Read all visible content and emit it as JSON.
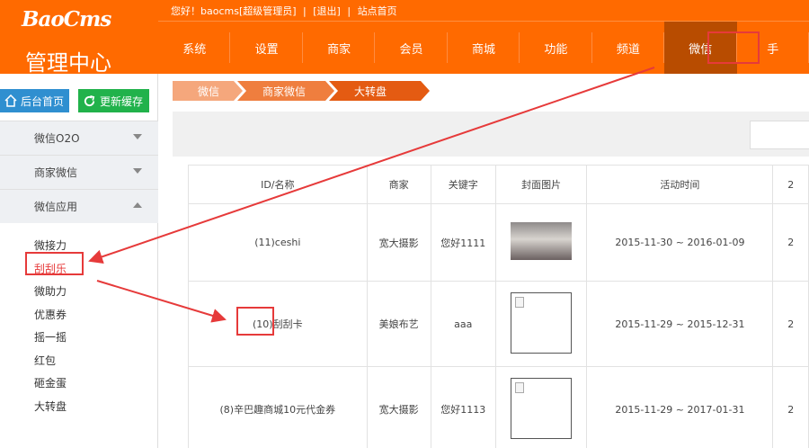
{
  "header": {
    "brand": "BaoCms",
    "admin_title": "管理中心",
    "greeting": "您好！baocms[超级管理员]",
    "sep1": "|",
    "logout": "[退出]",
    "sep2": "|",
    "site_home": "站点首页"
  },
  "nav": {
    "items": [
      "系统",
      "设置",
      "商家",
      "会员",
      "商城",
      "功能",
      "频道",
      "微信",
      "手"
    ],
    "active": "微信"
  },
  "sidebar": {
    "home_button": "后台首页",
    "refresh_button": "更新缓存",
    "sections": [
      "微信O2O",
      "商家微信",
      "微信应用"
    ],
    "submenu": [
      "微接力",
      "刮刮乐",
      "微助力",
      "优惠券",
      "摇一摇",
      "红包",
      "砸金蛋",
      "大转盘"
    ]
  },
  "breadcrumb": [
    "微信",
    "商家微信",
    "大转盘"
  ],
  "table": {
    "headers": [
      "ID/名称",
      "商家",
      "关键字",
      "封面图片",
      "活动时间",
      "2"
    ],
    "rows": [
      {
        "id_name": "(11)ceshi",
        "merchant": "宽大摄影",
        "keyword": "您好1111",
        "cover": "photo",
        "date_from": "2015-11-30",
        "date_sep": "~",
        "date_to": "2016-01-09",
        "extra": "2"
      },
      {
        "id_name": "(10)刮刮卡",
        "merchant": "美娘布艺",
        "keyword": "aaa",
        "cover": "broken-image",
        "date_from": "2015-11-29",
        "date_sep": "~",
        "date_to": "2015-12-31",
        "extra": "2"
      },
      {
        "id_name": "(8)辛巴趣商城10元代金券",
        "merchant": "宽大摄影",
        "keyword": "您好1113",
        "cover": "broken-image",
        "date_from": "2015-11-29",
        "date_sep": "~",
        "date_to": "2017-01-31",
        "extra": "2"
      }
    ]
  },
  "colors": {
    "brand": "#ff6a00",
    "nav_active": "#b84c00",
    "crumb_light": "#f5a77c",
    "crumb_mid": "#ef7e3e",
    "crumb_dark": "#e45b12",
    "annotation": "#e63a3a"
  }
}
